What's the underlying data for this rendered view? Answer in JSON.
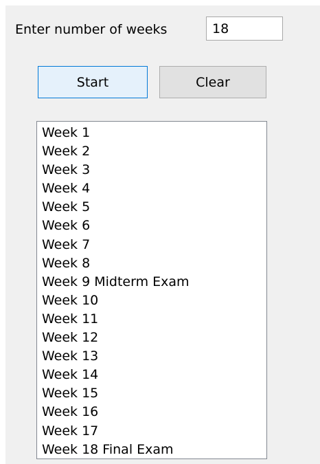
{
  "form": {
    "weeks_label": "Enter number of weeks",
    "weeks_value": "18",
    "start_label": "Start",
    "clear_label": "Clear"
  },
  "list": {
    "items": [
      "Week 1",
      "Week 2",
      "Week 3",
      "Week 4",
      "Week 5",
      "Week 6",
      "Week 7",
      "Week 8",
      "Week 9 Midterm Exam",
      "Week 10",
      "Week 11",
      "Week 12",
      "Week 13",
      "Week 14",
      "Week 15",
      "Week 16",
      "Week 17",
      "Week 18 Final Exam"
    ]
  },
  "colors": {
    "window_bg": "#f0f0f0",
    "start_button_border": "#0078d7",
    "start_button_bg": "#e5f1fb"
  }
}
